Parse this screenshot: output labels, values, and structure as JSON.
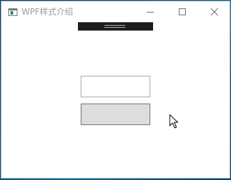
{
  "window": {
    "title": "WPF样式介绍",
    "icon": "window-app-icon",
    "controls": {
      "minimize_icon": "minimize-icon",
      "maximize_icon": "maximize-icon",
      "close_icon": "close-icon"
    }
  },
  "toolbar": {
    "icon": "drag-grip-icon"
  },
  "form": {
    "input_value": "",
    "button_label": ""
  },
  "colors": {
    "button_background": "#dddddd",
    "toolbar_background": "#1e1e1e",
    "title_text": "#9b9b9b"
  },
  "cursor": {
    "icon": "mouse-pointer-icon"
  }
}
